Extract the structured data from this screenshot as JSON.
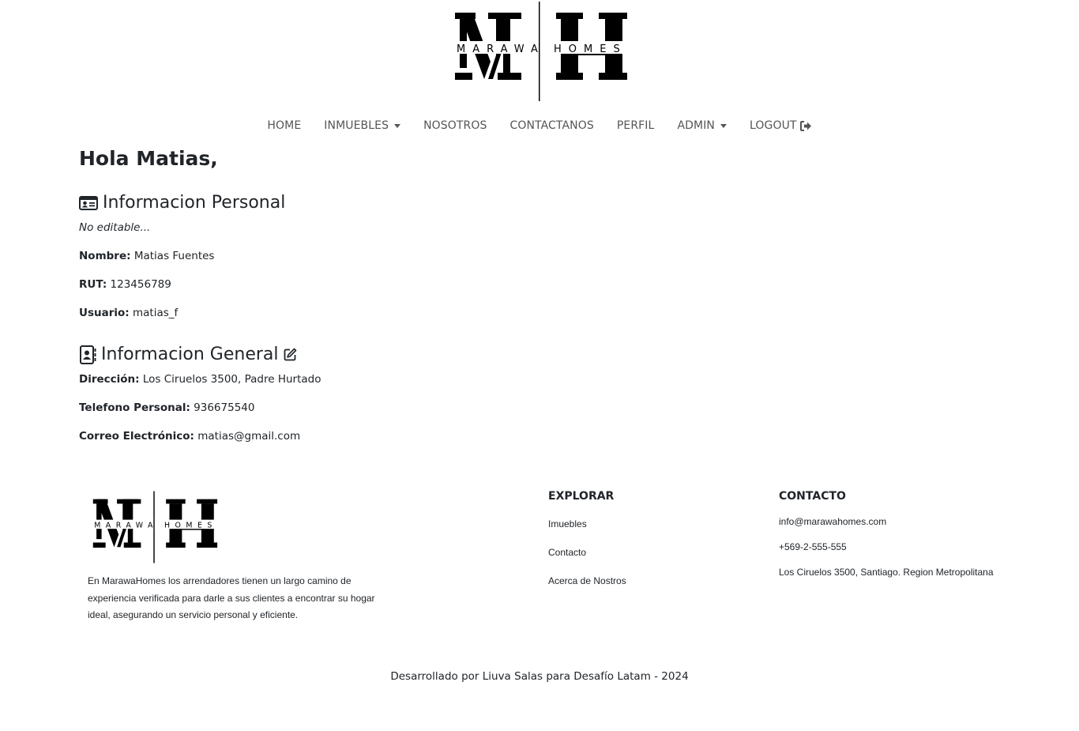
{
  "brand": {
    "left_word": "MARAWA",
    "right_word": "HOMES"
  },
  "nav": {
    "items": [
      {
        "label": "HOME",
        "dropdown": false
      },
      {
        "label": "INMUEBLES",
        "dropdown": true
      },
      {
        "label": "NOSOTROS",
        "dropdown": false
      },
      {
        "label": "CONTACTANOS",
        "dropdown": false
      },
      {
        "label": "PERFIL",
        "dropdown": false
      },
      {
        "label": "ADMIN",
        "dropdown": true
      },
      {
        "label": "LOGOUT",
        "dropdown": false,
        "icon": "sign-out-icon"
      }
    ]
  },
  "profile": {
    "greeting": "Hola Matias,",
    "personal": {
      "title": "Informacion Personal",
      "icon": "id-card-icon",
      "note": "No editable...",
      "fields": [
        {
          "label": "Nombre:",
          "value": "Matias Fuentes"
        },
        {
          "label": "RUT:",
          "value": "123456789"
        },
        {
          "label": "Usuario:",
          "value": "matias_f"
        }
      ]
    },
    "general": {
      "title": "Informacion General",
      "icon": "address-book-icon",
      "edit_icon": "edit-icon",
      "fields": [
        {
          "label": "Dirección:",
          "value": "Los Ciruelos 3500, Padre Hurtado"
        },
        {
          "label": "Telefono Personal:",
          "value": "936675540"
        },
        {
          "label": "Correo Electrónico:",
          "value": "matias@gmail.com"
        }
      ]
    }
  },
  "footer": {
    "description": "En MarawaHomes los arrendadores tienen un largo camino de experiencia verificada para darle a sus clientes a encontrar su hogar ideal, asegurando un servicio personal y eficiente.",
    "explore": {
      "heading": "EXPLORAR",
      "links": [
        "Imuebles",
        "Contacto",
        "Acerca de Nostros"
      ]
    },
    "contact": {
      "heading": "CONTACTO",
      "items": [
        "info@marawahomes.com",
        "+569-2-555-555",
        "Los Ciruelos 3500, Santiago. Region Metropolitana"
      ]
    },
    "credit": "Desarrollado por Liuva Salas para Desafío Latam - 2024"
  },
  "colors": {
    "text": "#212529",
    "nav_text": "#555555",
    "logo": "#000000",
    "background": "#ffffff"
  }
}
